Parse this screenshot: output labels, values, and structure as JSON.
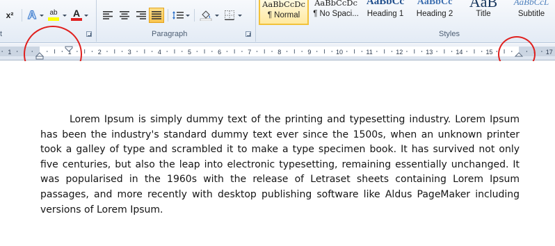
{
  "ribbon": {
    "groups": {
      "font_label": "t",
      "paragraph_label": "Paragraph",
      "styles_label": "Styles"
    },
    "font_tools": {
      "superscript_label": "x²",
      "text_effects_glyph": "A",
      "highlight_glyph": "ab",
      "font_color_glyph": "A",
      "highlight_color": "#ffff00",
      "font_color": "#e02020"
    },
    "styles": [
      {
        "sample": "AaBbCcDc",
        "name": "¶ Normal",
        "selected": true
      },
      {
        "sample": "AaBbCcDc",
        "name": "¶ No Spaci...",
        "selected": false
      },
      {
        "sample": "AaBbCc",
        "name": "Heading 1",
        "selected": false
      },
      {
        "sample": "AaBbCc",
        "name": "Heading 2",
        "selected": false
      },
      {
        "sample": "AaB",
        "name": "Title",
        "selected": false
      },
      {
        "sample": "AaBbCcL",
        "name": "Subtitle",
        "selected": false
      }
    ]
  },
  "ruler": {
    "numbers_left": [
      "1"
    ],
    "numbers": [
      "1",
      "2",
      "3",
      "4",
      "5",
      "6",
      "7",
      "8",
      "9",
      "10",
      "11",
      "12",
      "13",
      "14",
      "15",
      "17"
    ],
    "annotation_color": "#e0201e"
  },
  "document": {
    "paragraph": "Lorem Ipsum is simply dummy text of the printing and typesetting industry. Lorem Ipsum has been the industry's standard dummy text ever since the 1500s, when an unknown printer took a galley of type and scrambled it to make a type specimen book. It has survived not only five centuries, but also the leap into electronic typesetting, remaining essentially unchanged. It was popularised in the 1960s with the release of Letraset sheets containing Lorem Ipsum passages, and more recently with desktop publishing software like Aldus PageMaker including versions of Lorem Ipsum."
  }
}
